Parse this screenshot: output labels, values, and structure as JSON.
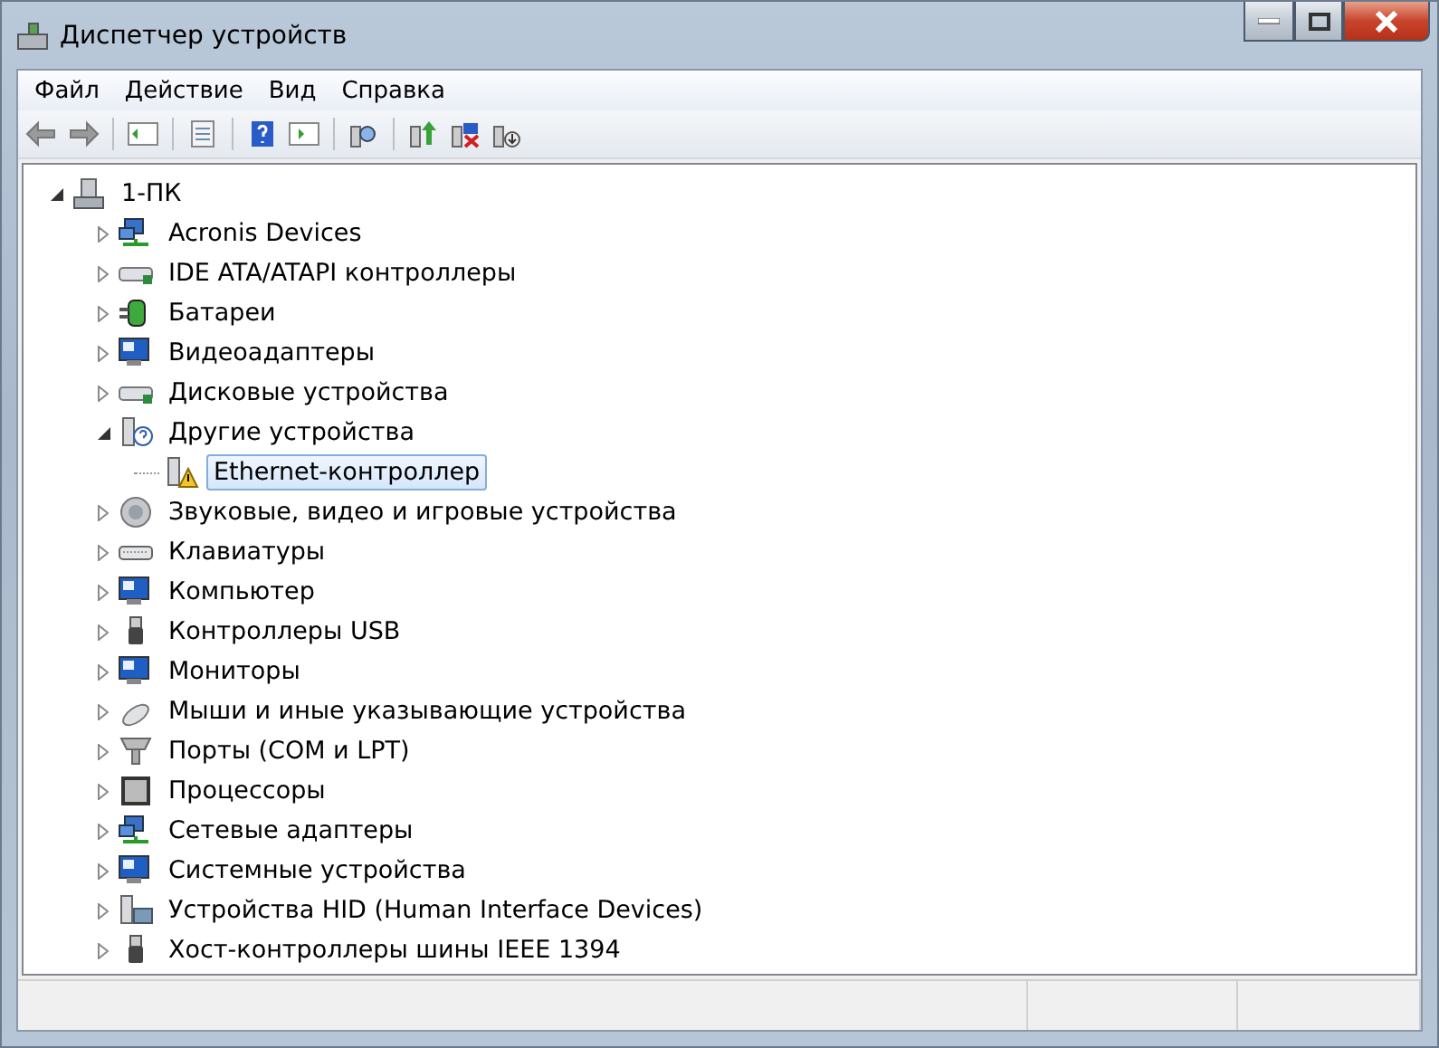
{
  "window": {
    "title": "Диспетчер устройств"
  },
  "menu": [
    "Файл",
    "Действие",
    "Вид",
    "Справка"
  ],
  "tree": {
    "label": "1-ПК",
    "kind": "computer",
    "expanded": true,
    "selected": false,
    "children": [
      {
        "label": "Acronis Devices",
        "kind": "network",
        "expanded": false,
        "selected": false
      },
      {
        "label": "IDE ATA/ATAPI контроллеры",
        "kind": "drive",
        "expanded": false,
        "selected": false
      },
      {
        "label": "Батареи",
        "kind": "battery",
        "expanded": false,
        "selected": false
      },
      {
        "label": "Видеоадаптеры",
        "kind": "monitor",
        "expanded": false,
        "selected": false
      },
      {
        "label": "Дисковые устройства",
        "kind": "drive",
        "expanded": false,
        "selected": false
      },
      {
        "label": "Другие устройства",
        "kind": "unknown",
        "expanded": true,
        "selected": false,
        "children": [
          {
            "label": "Ethernet-контроллер",
            "kind": "warning",
            "selected": true
          }
        ]
      },
      {
        "label": "Звуковые, видео и игровые устройства",
        "kind": "speaker",
        "expanded": false,
        "selected": false
      },
      {
        "label": "Клавиатуры",
        "kind": "keyboard",
        "expanded": false,
        "selected": false
      },
      {
        "label": "Компьютер",
        "kind": "monitor",
        "expanded": false,
        "selected": false
      },
      {
        "label": "Контроллеры USB",
        "kind": "plug",
        "expanded": false,
        "selected": false
      },
      {
        "label": "Мониторы",
        "kind": "monitor",
        "expanded": false,
        "selected": false
      },
      {
        "label": "Мыши и иные указывающие устройства",
        "kind": "mouse",
        "expanded": false,
        "selected": false
      },
      {
        "label": "Порты (COM и LPT)",
        "kind": "port",
        "expanded": false,
        "selected": false
      },
      {
        "label": "Процессоры",
        "kind": "chip",
        "expanded": false,
        "selected": false
      },
      {
        "label": "Сетевые адаптеры",
        "kind": "network",
        "expanded": false,
        "selected": false
      },
      {
        "label": "Системные устройства",
        "kind": "monitor",
        "expanded": false,
        "selected": false
      },
      {
        "label": "Устройства HID (Human Interface Devices)",
        "kind": "hid",
        "expanded": false,
        "selected": false
      },
      {
        "label": "Хост-контроллеры шины IEEE 1394",
        "kind": "plug",
        "expanded": false,
        "selected": false
      }
    ]
  }
}
